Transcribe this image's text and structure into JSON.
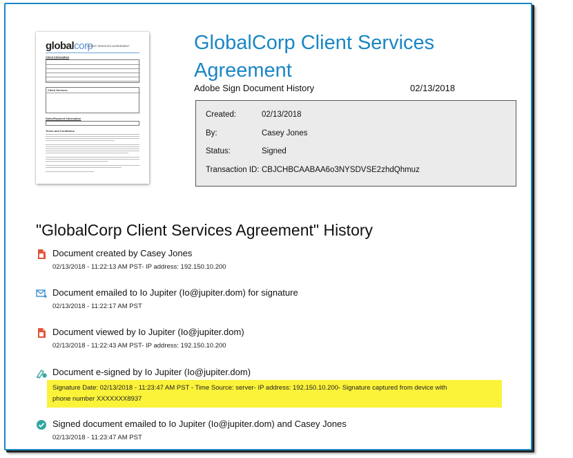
{
  "colors": {
    "accent": "#1a86c4",
    "created_icon": "#e0553a",
    "email_icon": "#3f8fd0",
    "esign_icon": "#3aa6a0",
    "check_icon": "#2ea7a0",
    "highlight": "#fbf23a"
  },
  "thumbnail": {
    "logo_main": "global",
    "logo_suffix": "corp",
    "header": "CLIENT SERVICES AGREEMENT",
    "section_client": "Client Information",
    "section_services": "Client Services",
    "section_payment": "Sales/Payment Information",
    "section_terms": "Terms and Conditions"
  },
  "document": {
    "title": "GlobalCorp Client Services Agreement",
    "history_label": "Adobe Sign Document History",
    "history_date": "02/13/2018"
  },
  "info": [
    {
      "label": "Created:",
      "value": "02/13/2018"
    },
    {
      "label": "By:",
      "value": "Casey Jones"
    },
    {
      "label": "Status:",
      "value": "Signed"
    },
    {
      "label": "Transaction ID:",
      "value": "CBJCHBCAABAA6o3NYSDVSE2zhdQhmuz"
    }
  ],
  "history": {
    "title": "\"GlobalCorp Client Services Agreement\" History",
    "events": [
      {
        "icon": "document-created-icon",
        "title": "Document created by Casey Jones",
        "detail": "02/13/2018 - 11:22:13 AM PST- IP address: 192.150.10.200"
      },
      {
        "icon": "email-sent-icon",
        "title": "Document emailed to Io Jupiter (Io@jupiter.dom) for signature",
        "detail": "02/13/2018 - 11:22:17 AM PST"
      },
      {
        "icon": "document-viewed-icon",
        "title": "Document viewed by Io Jupiter (Io@jupiter.dom)",
        "detail": "02/13/2018 - 11:22:43 AM PST- IP address: 192.150.10.200"
      },
      {
        "icon": "esign-pen-icon",
        "title": "Document e-signed by Io Jupiter (Io@jupiter.dom)",
        "detail_line1": "Signature Date: 02/13/2018 - 11:23:47 AM PST - Time Source: server- IP address: 192.150.10.200- Signature captured from device with",
        "detail_line2": "phone number XXXXXXX8937"
      },
      {
        "icon": "check-circle-icon",
        "title": "Signed document emailed to Io Jupiter (Io@jupiter.dom) and Casey Jones",
        "detail": "02/13/2018 - 11:23:47 AM PST"
      }
    ]
  }
}
